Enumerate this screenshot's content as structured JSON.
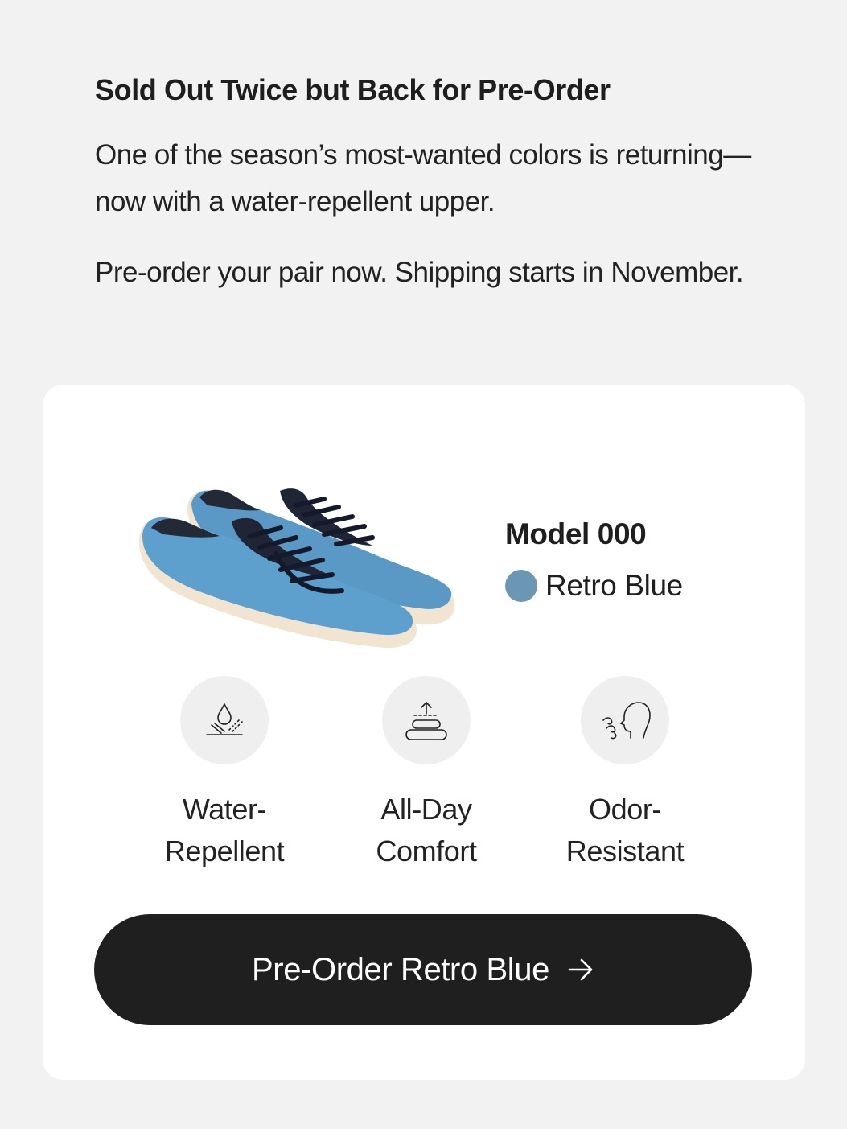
{
  "intro": {
    "headline": "Sold Out Twice but Back for Pre-Order",
    "paragraph_1": "One of the season’s most-wanted colors is returning—now with a water-repellent upper.",
    "paragraph_2": "Pre-order your pair now. Shipping starts in November."
  },
  "product": {
    "model": "Model 000",
    "color_name": "Retro Blue",
    "swatch_color": "#6b97b4",
    "image_icon": "sneaker-pair-image"
  },
  "features": [
    {
      "icon": "water-drop-icon",
      "label": "Water-\nRepellent"
    },
    {
      "icon": "stacked-cushion-icon",
      "label": "All-Day\nComfort"
    },
    {
      "icon": "face-breath-icon",
      "label": "Odor-\nResistant"
    }
  ],
  "cta": {
    "label": "Pre-Order Retro Blue",
    "icon": "arrow-right-icon",
    "background": "#1f1f1f"
  }
}
